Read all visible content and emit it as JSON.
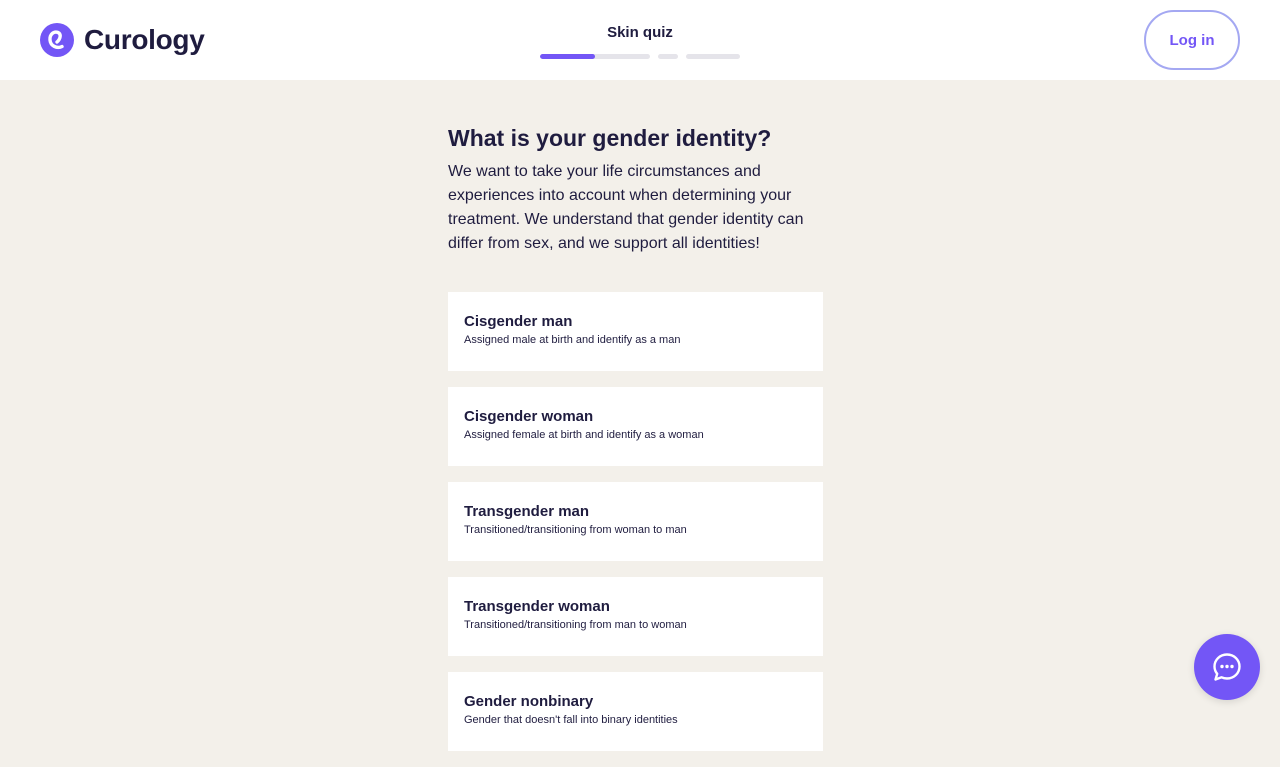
{
  "header": {
    "brand_name": "Curology",
    "logo_icon": "curology-logo-icon",
    "quiz_title": "Skin quiz",
    "progress_segments": [
      {
        "fill": 0.5
      },
      {
        "fill": 0
      },
      {
        "fill": 0
      },
      {
        "fill": 0
      }
    ],
    "login_label": "Log in"
  },
  "main": {
    "question": "What is your gender identity?",
    "description": "We want to take your life circumstances and experiences into account when determining your treatment. We understand that gender identity can differ from sex, and we support all identities!",
    "options": [
      {
        "title": "Cisgender man",
        "subtitle": "Assigned male at birth and identify as a man"
      },
      {
        "title": "Cisgender woman",
        "subtitle": "Assigned female at birth and identify as a woman"
      },
      {
        "title": "Transgender man",
        "subtitle": "Transitioned/transitioning from woman to man"
      },
      {
        "title": "Transgender woman",
        "subtitle": "Transitioned/transitioning from man to woman"
      },
      {
        "title": "Gender nonbinary",
        "subtitle": "Gender that doesn't fall into binary identities"
      }
    ]
  },
  "chat": {
    "icon": "chat-bubble-icon"
  },
  "colors": {
    "accent": "#7356f6",
    "background": "#f3f0ea",
    "text": "#1f1c3f",
    "login_border": "#a4a8f2"
  }
}
